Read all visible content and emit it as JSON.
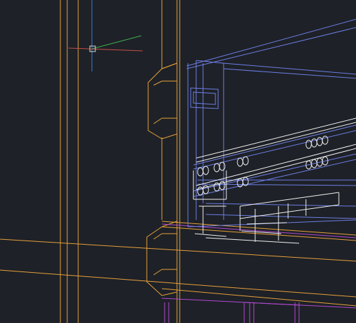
{
  "viewport": {
    "background": "#1e2127",
    "layer_colors": {
      "frame": "#e9a23b",
      "structure": "#6d7fe8",
      "hardware": "#f2f2f2",
      "section": "#b24ad6"
    }
  },
  "ucs_icon": {
    "x_axis_color": "#c8504a",
    "y_axis_color": "#3fb050",
    "z_axis_color": "#3b7fd6"
  },
  "crosshair": {
    "color": "#d9d9d9"
  }
}
